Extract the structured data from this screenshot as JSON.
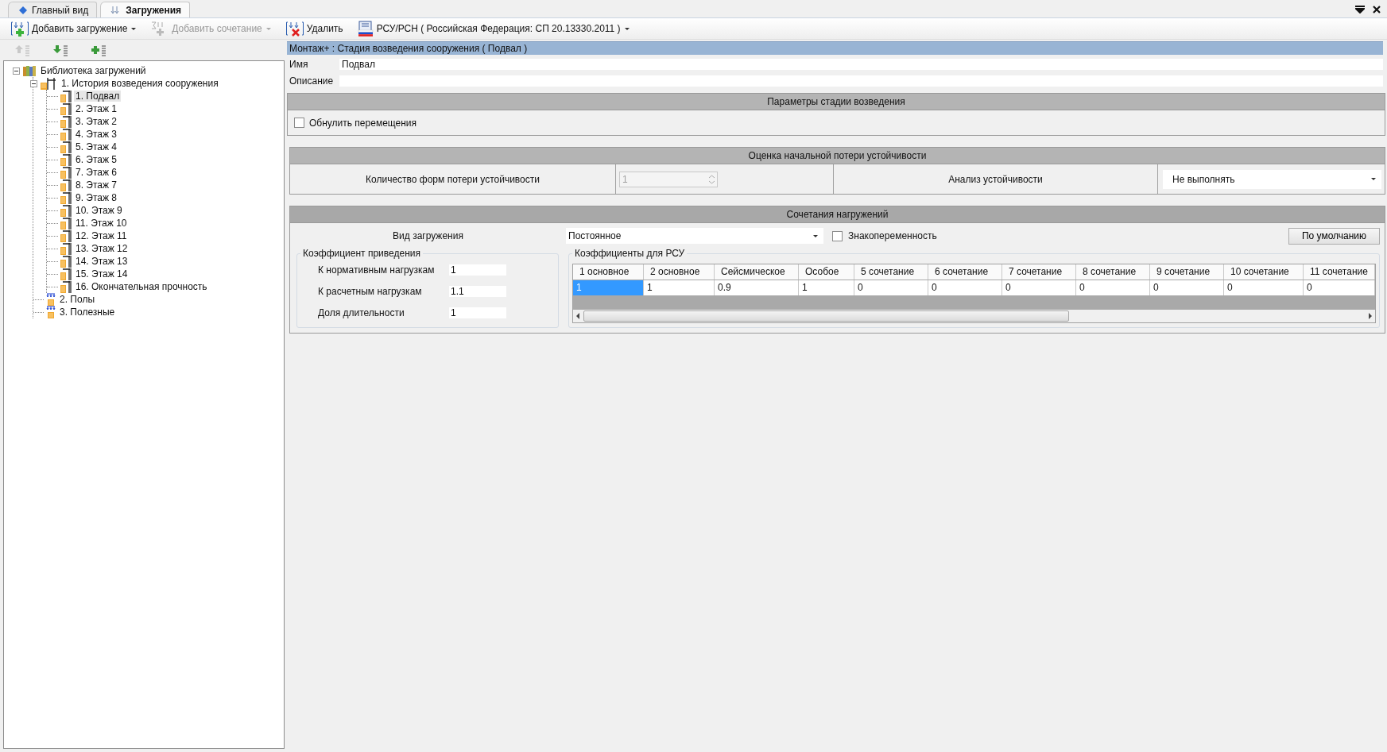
{
  "tabs": [
    {
      "label": "Главный вид",
      "kind": "main",
      "selected": false
    },
    {
      "label": "Загружения",
      "kind": "loads",
      "selected": true
    }
  ],
  "toolbar": [
    {
      "label": "Добавить загружение",
      "kind": "add-load",
      "disabled": false,
      "dropdown": true
    },
    {
      "label": "Добавить сочетание",
      "kind": "add-combination",
      "disabled": true,
      "dropdown": true
    },
    {
      "label": "Удалить",
      "kind": "delete",
      "disabled": false,
      "dropdown": false
    },
    {
      "label": "РСУ/РСН ( Российская Федерация: СП 20.13330.2011 )",
      "kind": "norms",
      "disabled": false,
      "dropdown": true
    }
  ],
  "tree_toolbar": [
    {
      "kind": "move-up",
      "disabled": true
    },
    {
      "kind": "move-down",
      "disabled": false
    },
    {
      "kind": "add",
      "disabled": false
    }
  ],
  "tree": {
    "label": "Библиотека загружений",
    "kind": "library",
    "expanded": true,
    "selected": false,
    "children": [
      {
        "label": "1. История возведения сооружения",
        "kind": "stage-group",
        "expanded": true,
        "selected": false,
        "children": [
          {
            "label": "1. Подвал",
            "kind": "stage",
            "selected": true
          },
          {
            "label": "2. Этаж 1",
            "kind": "stage",
            "selected": false
          },
          {
            "label": "3. Этаж 2",
            "kind": "stage",
            "selected": false
          },
          {
            "label": "4. Этаж 3",
            "kind": "stage",
            "selected": false
          },
          {
            "label": "5. Этаж 4",
            "kind": "stage",
            "selected": false
          },
          {
            "label": "6. Этаж 5",
            "kind": "stage",
            "selected": false
          },
          {
            "label": "7. Этаж 6",
            "kind": "stage",
            "selected": false
          },
          {
            "label": "8. Этаж 7",
            "kind": "stage",
            "selected": false
          },
          {
            "label": "9. Этаж 8",
            "kind": "stage",
            "selected": false
          },
          {
            "label": "10. Этаж 9",
            "kind": "stage",
            "selected": false
          },
          {
            "label": "11. Этаж 10",
            "kind": "stage",
            "selected": false
          },
          {
            "label": "12. Этаж 11",
            "kind": "stage",
            "selected": false
          },
          {
            "label": "13. Этаж 12",
            "kind": "stage",
            "selected": false
          },
          {
            "label": "14. Этаж 13",
            "kind": "stage",
            "selected": false
          },
          {
            "label": "15. Этаж 14",
            "kind": "stage",
            "selected": false
          },
          {
            "label": "16. Окончательная прочность",
            "kind": "stage",
            "selected": false
          }
        ]
      },
      {
        "label": "2. Полы",
        "kind": "load",
        "selected": false
      },
      {
        "label": "3. Полезные",
        "kind": "load",
        "selected": false
      }
    ]
  },
  "header": "Монтаж+ : Стадия возведения сооружения ( Подвал )",
  "name_field": {
    "label": "Имя",
    "value": "Подвал"
  },
  "description_field": {
    "label": "Описание"
  },
  "stage_params": {
    "title": "Параметры стадии возведения",
    "reset": {
      "label": "Обнулить перемещения",
      "checked": false
    }
  },
  "stability": {
    "title": "Оценка начальной потери устойчивости",
    "forms_label": "Количество форм потери устойчивости",
    "forms": {
      "value": "1",
      "disabled": true
    },
    "analysis_label": "Анализ устойчивости",
    "analysis": "Не выполнять"
  },
  "combinations": {
    "title": "Сочетания нагружений",
    "load_type_label": "Вид загружения",
    "load_type": "Постоянное",
    "alternating": {
      "label": "Знакопеременность",
      "checked": false
    },
    "default_button": "По умолчанию",
    "reduction": {
      "title": "Коэффициент приведения",
      "rows": [
        {
          "label": "К нормативным нагрузкам",
          "value": "1"
        },
        {
          "label": "К расчетным нагрузкам",
          "value": "1.1"
        },
        {
          "label": "Доля длительности",
          "value": "1"
        }
      ]
    },
    "rsu": {
      "title": "Коэффициенты для РСУ",
      "columns": [
        "1 основное",
        "2 основное",
        "Сейсмическое",
        "Особое",
        "5 сочетание",
        "6 сочетание",
        "7 сочетание",
        "8 сочетание",
        "9 сочетание",
        "10 сочетание",
        "11 сочетание"
      ],
      "rows": [
        [
          {
            "value": "1",
            "selected": true
          },
          {
            "value": "1",
            "selected": false
          },
          {
            "value": "0.9",
            "selected": false
          },
          {
            "value": "1",
            "selected": false
          },
          {
            "value": "0",
            "selected": false
          },
          {
            "value": "0",
            "selected": false
          },
          {
            "value": "0",
            "selected": false
          },
          {
            "value": "0",
            "selected": false
          },
          {
            "value": "0",
            "selected": false
          },
          {
            "value": "0",
            "selected": false
          },
          {
            "value": "0",
            "selected": false
          }
        ]
      ]
    }
  }
}
